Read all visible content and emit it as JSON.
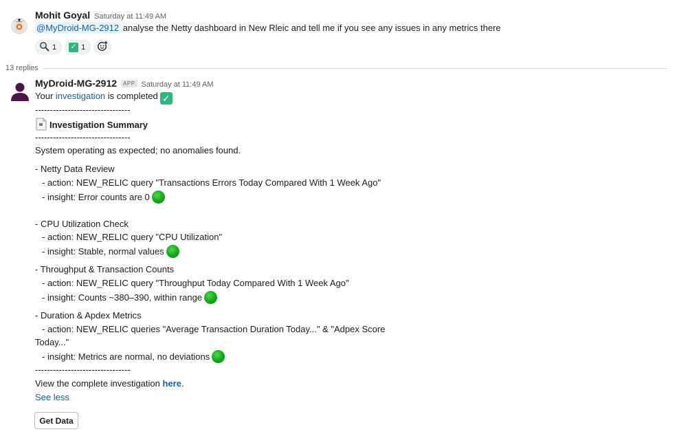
{
  "thread": {
    "parent": {
      "author": "Mohit Goyal",
      "timestamp": "Saturday at 11:49 AM",
      "mention": "@MyDroid-MG-2912",
      "text": " analyse the Netty dashboard in New Rleic and tell me if you see any issues in any metrics there",
      "reactions": [
        {
          "icon": "magnifier-emoji",
          "count": "1"
        },
        {
          "icon": "check-mark-emoji",
          "count": "1"
        }
      ]
    },
    "replies_label": "13 replies",
    "reply": {
      "author": "MyDroid-MG-2912",
      "badge": "APP",
      "timestamp": "Saturday at 11:49 AM",
      "line_completed_pre": "Your ",
      "line_completed_link": "investigation",
      "line_completed_post": " is completed",
      "dashes": "--------------------------------",
      "summary_title": "Investigation Summary",
      "status": "System operating as expected; no anomalies found.",
      "sections": [
        {
          "title": "- Netty Data Review",
          "action": "- action: NEW_RELIC query \"Transactions Errors Today Compared With 1 Week Ago\"",
          "insight": "- insight: Error counts are 0"
        },
        {
          "title": "- CPU Utilization Check",
          "action": "- action: NEW_RELIC query \"CPU Utilization\"",
          "insight": "- insight: Stable, normal values"
        },
        {
          "title": "- Throughput & Transaction Counts",
          "action": "- action: NEW_RELIC query \"Throughput Today Compared With 1 Week Ago\"",
          "insight": "- insight: Counts ~380–390, within range"
        },
        {
          "title": "- Duration & Apdex Metrics",
          "action": "- action: NEW_RELIC queries \"Average Transaction Duration Today...\" & \"Adpex Score",
          "action_cont": "Today...\"",
          "insight": "- insight: Metrics are normal, no deviations"
        }
      ],
      "view_complete_pre": "View the complete investigation ",
      "view_complete_link": "here",
      "view_complete_post": ".",
      "see_less": "See less",
      "button": "Get Data"
    }
  },
  "colors": {
    "link": "#1264a3",
    "mention_bg": "#e8f3fa",
    "status_green": "#12a812",
    "check_green": "#2eb67d"
  }
}
